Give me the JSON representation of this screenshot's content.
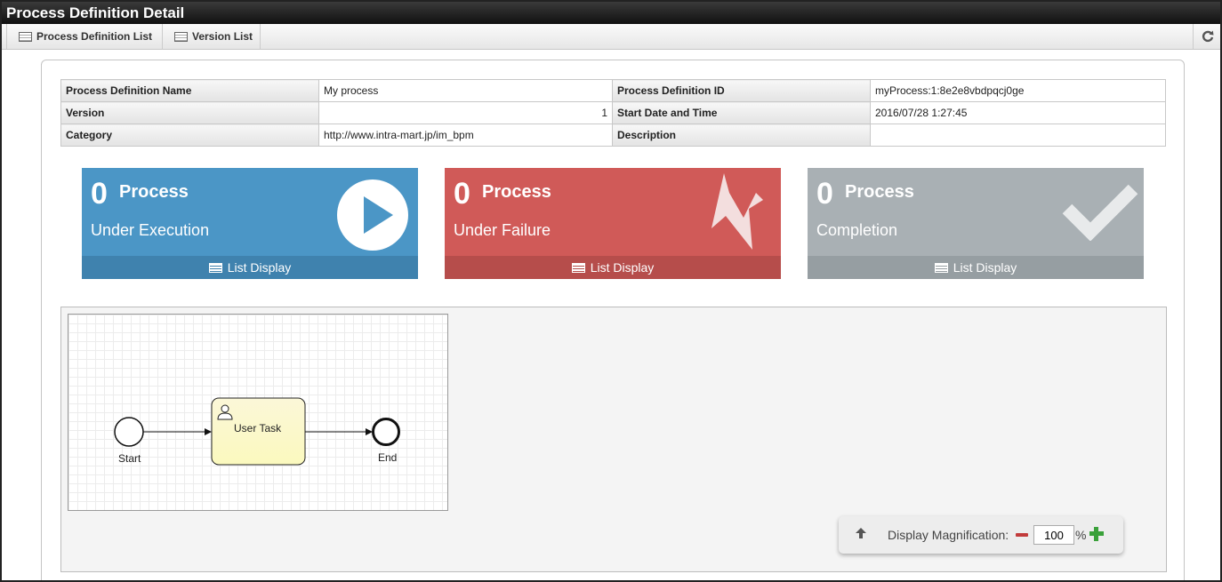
{
  "title": "Process Definition Detail",
  "toolbar": {
    "process_definition_list": "Process Definition List",
    "version_list": "Version List"
  },
  "info": {
    "name_label": "Process Definition Name",
    "name_value": "My process",
    "id_label": "Process Definition ID",
    "id_value": "myProcess:1:8e2e8vbdpqcj0ge",
    "version_label": "Version",
    "version_value": "1",
    "start_label": "Start Date and Time",
    "start_value": "2016/07/28 1:27:45",
    "category_label": "Category",
    "category_value": "http://www.intra-mart.jp/im_bpm",
    "description_label": "Description",
    "description_value": ""
  },
  "cards": [
    {
      "count": "0",
      "title": "Process",
      "subtitle": "Under Execution",
      "link": "List Display",
      "color": "#4b96c6"
    },
    {
      "count": "0",
      "title": "Process",
      "subtitle": "Under Failure",
      "link": "List Display",
      "color": "#d05a58"
    },
    {
      "count": "0",
      "title": "Process",
      "subtitle": "Completion",
      "link": "List Display",
      "color": "#a9b0b4"
    }
  ],
  "diagram": {
    "start_label": "Start",
    "task_label": "User Task",
    "end_label": "End"
  },
  "zoom": {
    "label": "Display Magnification:",
    "value": "100",
    "unit": "%"
  },
  "icons": {
    "toolbar": "list-icon",
    "refresh": "refresh-icon",
    "card1": "play-icon",
    "card2": "lightning-icon",
    "card3": "checkmark-icon",
    "task": "user-icon",
    "zoom_up": "arrow-up-icon"
  }
}
